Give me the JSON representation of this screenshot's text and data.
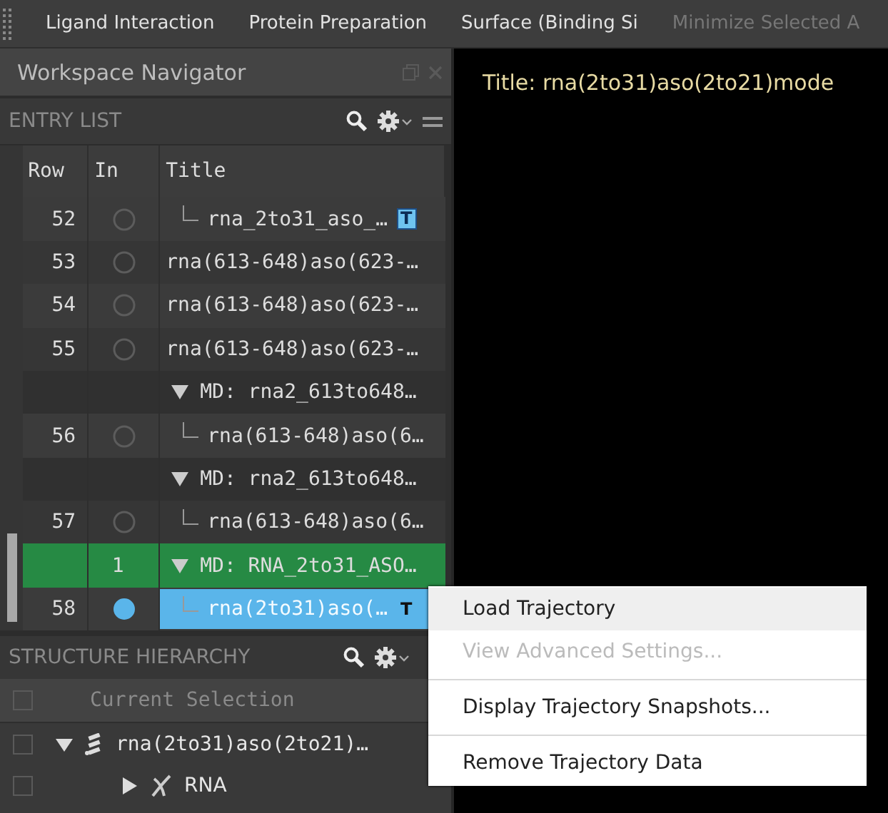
{
  "toolbar": {
    "items": [
      {
        "label": "Ligand Interaction",
        "disabled": false
      },
      {
        "label": "Protein Preparation",
        "disabled": false
      },
      {
        "label": "Surface (Binding Si",
        "disabled": false
      },
      {
        "label": "Minimize Selected A",
        "disabled": true
      }
    ]
  },
  "navigator": {
    "title": "Workspace Navigator",
    "entry_list": {
      "title": "ENTRY LIST",
      "columns": [
        "Row",
        "In",
        "Title"
      ],
      "rows": [
        {
          "kind": "entry",
          "row": "52",
          "included": false,
          "child": true,
          "title": "rna_2to31_aso_…",
          "badge": "T",
          "selected": false
        },
        {
          "kind": "entry",
          "row": "53",
          "included": false,
          "child": false,
          "title": "rna(613-648)aso(623-…",
          "selected": false
        },
        {
          "kind": "entry",
          "row": "54",
          "included": false,
          "child": false,
          "title": "rna(613-648)aso(623-…",
          "selected": false
        },
        {
          "kind": "entry",
          "row": "55",
          "included": false,
          "child": false,
          "title": "rna(613-648)aso(623-…",
          "selected": false
        },
        {
          "kind": "group",
          "title": "MD: rna2_613to648…",
          "expanded": true,
          "highlighted": false
        },
        {
          "kind": "entry",
          "row": "56",
          "included": false,
          "child": true,
          "title": "rna(613-648)aso(6…",
          "selected": false
        },
        {
          "kind": "group",
          "title": "MD: rna2_613to648…",
          "expanded": true,
          "highlighted": false
        },
        {
          "kind": "entry",
          "row": "57",
          "included": false,
          "child": true,
          "title": "rna(613-648)aso(6…",
          "selected": false
        },
        {
          "kind": "group",
          "count": "1",
          "title": "MD: RNA_2to31_ASO…",
          "expanded": true,
          "highlighted": true
        },
        {
          "kind": "entry",
          "row": "58",
          "included": true,
          "child": true,
          "title": "rna(2to31)aso(…",
          "badge": "T",
          "selected": true
        }
      ]
    },
    "structure_hierarchy": {
      "title": "STRUCTURE HIERARCHY",
      "current_selection": {
        "label": "Current Selection",
        "checked": false
      },
      "items": [
        {
          "kind": "molecule",
          "label": "rna(2to31)aso(2to21)…",
          "checked": false,
          "expanded": true,
          "children": [
            {
              "kind": "chain",
              "label": "RNA",
              "checked": false,
              "expanded": false
            }
          ]
        }
      ]
    }
  },
  "viewport": {
    "title": "Title: rna(2to31)aso(2to21)mode"
  },
  "context_menu": {
    "items": [
      {
        "label": "Load Trajectory",
        "disabled": false,
        "hovered": true,
        "separator_before": false
      },
      {
        "label": "View Advanced Settings...",
        "disabled": true,
        "hovered": false,
        "separator_before": false
      },
      {
        "label": "Display Trajectory Snapshots...",
        "disabled": false,
        "hovered": false,
        "separator_before": true
      },
      {
        "label": "Remove Trajectory Data",
        "disabled": false,
        "hovered": false,
        "separator_before": true
      }
    ]
  }
}
